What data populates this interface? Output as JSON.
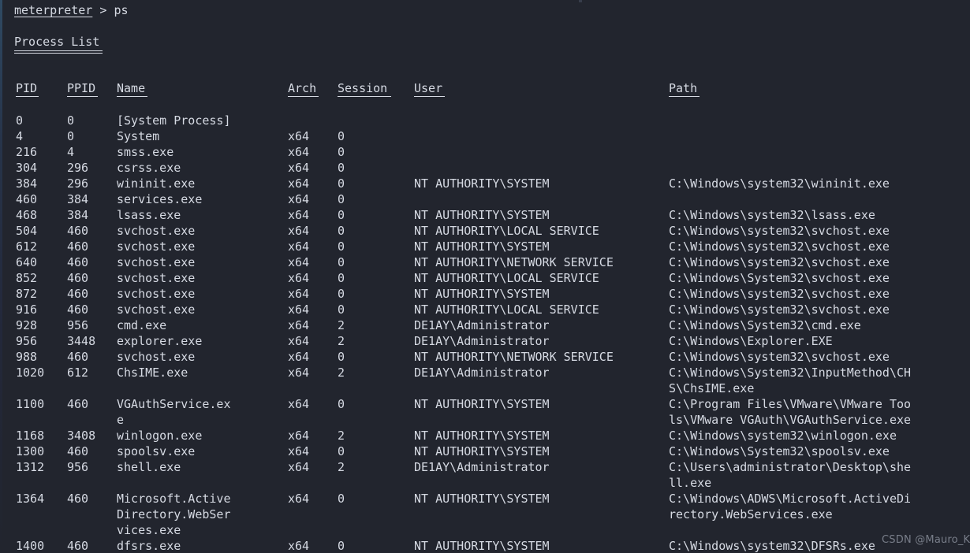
{
  "terminal": {
    "prompt_name": "meterpreter",
    "prompt_symbol": ">",
    "command": "ps",
    "title": "Process List",
    "background_color": "#22252e",
    "text_color": "#d6dae3"
  },
  "watermark": {
    "text": "CSDN @Mauro_K"
  },
  "table": {
    "headers": {
      "pid": "PID",
      "ppid": "PPID",
      "name": "Name",
      "arch": "Arch",
      "session": "Session",
      "user": "User",
      "path": "Path"
    },
    "rows": [
      {
        "pid": "0",
        "ppid": "0",
        "name": "[System Process]",
        "arch": "",
        "session": "",
        "user": "",
        "path": ""
      },
      {
        "pid": "4",
        "ppid": "0",
        "name": "System",
        "arch": "x64",
        "session": "0",
        "user": "",
        "path": ""
      },
      {
        "pid": "216",
        "ppid": "4",
        "name": "smss.exe",
        "arch": "x64",
        "session": "0",
        "user": "",
        "path": ""
      },
      {
        "pid": "304",
        "ppid": "296",
        "name": "csrss.exe",
        "arch": "x64",
        "session": "0",
        "user": "",
        "path": ""
      },
      {
        "pid": "384",
        "ppid": "296",
        "name": "wininit.exe",
        "arch": "x64",
        "session": "0",
        "user": "NT AUTHORITY\\SYSTEM",
        "path": "C:\\Windows\\system32\\wininit.exe"
      },
      {
        "pid": "460",
        "ppid": "384",
        "name": "services.exe",
        "arch": "x64",
        "session": "0",
        "user": "",
        "path": ""
      },
      {
        "pid": "468",
        "ppid": "384",
        "name": "lsass.exe",
        "arch": "x64",
        "session": "0",
        "user": "NT AUTHORITY\\SYSTEM",
        "path": "C:\\Windows\\system32\\lsass.exe"
      },
      {
        "pid": "504",
        "ppid": "460",
        "name": "svchost.exe",
        "arch": "x64",
        "session": "0",
        "user": "NT AUTHORITY\\LOCAL SERVICE",
        "path": "C:\\Windows\\system32\\svchost.exe"
      },
      {
        "pid": "612",
        "ppid": "460",
        "name": "svchost.exe",
        "arch": "x64",
        "session": "0",
        "user": "NT AUTHORITY\\SYSTEM",
        "path": "C:\\Windows\\system32\\svchost.exe"
      },
      {
        "pid": "640",
        "ppid": "460",
        "name": "svchost.exe",
        "arch": "x64",
        "session": "0",
        "user": "NT AUTHORITY\\NETWORK SERVICE",
        "path": "C:\\Windows\\system32\\svchost.exe"
      },
      {
        "pid": "852",
        "ppid": "460",
        "name": "svchost.exe",
        "arch": "x64",
        "session": "0",
        "user": "NT AUTHORITY\\LOCAL SERVICE",
        "path": "C:\\Windows\\System32\\svchost.exe"
      },
      {
        "pid": "872",
        "ppid": "460",
        "name": "svchost.exe",
        "arch": "x64",
        "session": "0",
        "user": "NT AUTHORITY\\SYSTEM",
        "path": "C:\\Windows\\system32\\svchost.exe"
      },
      {
        "pid": "916",
        "ppid": "460",
        "name": "svchost.exe",
        "arch": "x64",
        "session": "0",
        "user": "NT AUTHORITY\\LOCAL SERVICE",
        "path": "C:\\Windows\\system32\\svchost.exe"
      },
      {
        "pid": "928",
        "ppid": "956",
        "name": "cmd.exe",
        "arch": "x64",
        "session": "2",
        "user": "DE1AY\\Administrator",
        "path": "C:\\Windows\\System32\\cmd.exe"
      },
      {
        "pid": "956",
        "ppid": "3448",
        "name": "explorer.exe",
        "arch": "x64",
        "session": "2",
        "user": "DE1AY\\Administrator",
        "path": "C:\\Windows\\Explorer.EXE"
      },
      {
        "pid": "988",
        "ppid": "460",
        "name": "svchost.exe",
        "arch": "x64",
        "session": "0",
        "user": "NT AUTHORITY\\NETWORK SERVICE",
        "path": "C:\\Windows\\system32\\svchost.exe"
      },
      {
        "pid": "1020",
        "ppid": "612",
        "name": "ChsIME.exe",
        "arch": "x64",
        "session": "2",
        "user": "DE1AY\\Administrator",
        "path": "C:\\Windows\\System32\\InputMethod\\CHS\\ChsIME.exe"
      },
      {
        "pid": "1100",
        "ppid": "460",
        "name": "VGAuthService.exe",
        "arch": "x64",
        "session": "0",
        "user": "NT AUTHORITY\\SYSTEM",
        "path": "C:\\Program Files\\VMware\\VMware Tools\\VMware VGAuth\\VGAuthService.exe"
      },
      {
        "pid": "1168",
        "ppid": "3408",
        "name": "winlogon.exe",
        "arch": "x64",
        "session": "2",
        "user": "NT AUTHORITY\\SYSTEM",
        "path": "C:\\Windows\\system32\\winlogon.exe"
      },
      {
        "pid": "1300",
        "ppid": "460",
        "name": "spoolsv.exe",
        "arch": "x64",
        "session": "0",
        "user": "NT AUTHORITY\\SYSTEM",
        "path": "C:\\Windows\\System32\\spoolsv.exe"
      },
      {
        "pid": "1312",
        "ppid": "956",
        "name": "shell.exe",
        "arch": "x64",
        "session": "2",
        "user": "DE1AY\\Administrator",
        "path": "C:\\Users\\administrator\\Desktop\\shell.exe"
      },
      {
        "pid": "1364",
        "ppid": "460",
        "name": "Microsoft.ActiveDirectory.WebServices.exe",
        "arch": "x64",
        "session": "0",
        "user": "NT AUTHORITY\\SYSTEM",
        "path": "C:\\Windows\\ADWS\\Microsoft.ActiveDirectory.WebServices.exe"
      },
      {
        "pid": "1400",
        "ppid": "460",
        "name": "dfsrs.exe",
        "arch": "x64",
        "session": "0",
        "user": "NT AUTHORITY\\SYSTEM",
        "path": "C:\\Windows\\system32\\DFSRs.exe"
      }
    ],
    "wrap": {
      "name_chars": 16,
      "path_chars": 34
    }
  }
}
